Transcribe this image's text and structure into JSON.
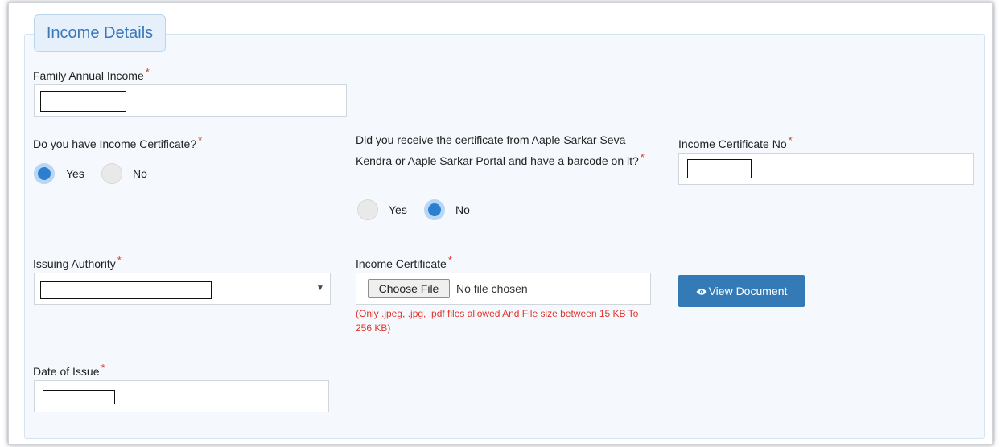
{
  "section": {
    "legend": "Income Details"
  },
  "family_income": {
    "label": "Family Annual Income",
    "required": "*",
    "value": ""
  },
  "has_certificate": {
    "label": "Do you have Income Certificate?",
    "required": "*",
    "options": [
      {
        "label": "Yes",
        "selected": true
      },
      {
        "label": "No",
        "selected": false
      }
    ]
  },
  "barcode": {
    "label": "Did you receive the certificate from Aaple Sarkar Seva Kendra or Aaple Sarkar Portal and have a barcode on it?",
    "required": "*",
    "options": [
      {
        "label": "Yes",
        "selected": false
      },
      {
        "label": "No",
        "selected": true
      }
    ]
  },
  "certificate_no": {
    "label": "Income Certificate No",
    "required": "*",
    "value": ""
  },
  "issuing_authority": {
    "label": "Issuing Authority",
    "required": "*",
    "selected": ""
  },
  "income_certificate": {
    "label": "Income Certificate",
    "required": "*",
    "choose_button": "Choose File",
    "status": "No file chosen",
    "hint": "(Only .jpeg, .jpg, .pdf files allowed And File size between 15 KB To 256 KB)"
  },
  "view_document": {
    "label": "View Document",
    "icon": "eye-icon"
  },
  "date_of_issue": {
    "label": "Date of Issue",
    "required": "*",
    "value": ""
  },
  "colors": {
    "accent": "#337ab7",
    "required": "#e2342a",
    "legend_text": "#3b78b9",
    "radio_on": "#2b7fd0"
  }
}
